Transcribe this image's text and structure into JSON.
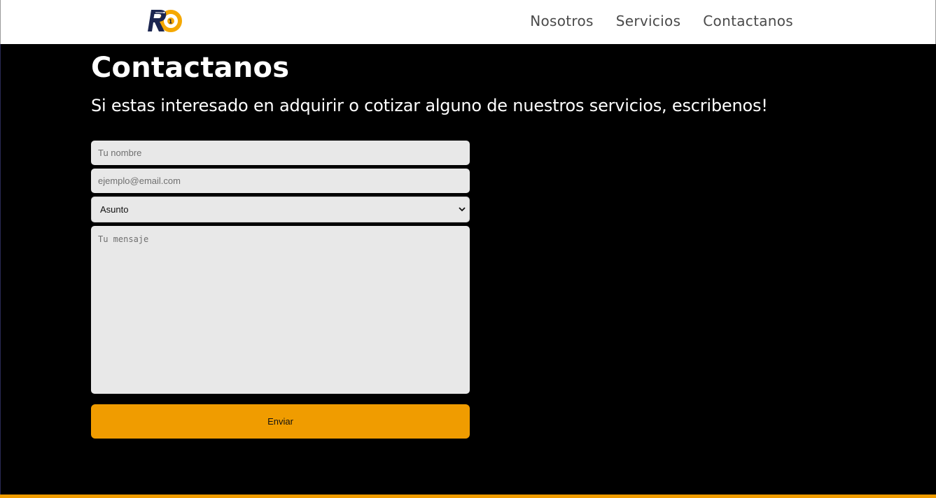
{
  "brand": {
    "logo_text": "R1",
    "colors": {
      "primary": "#1b2550",
      "accent": "#f5a800"
    }
  },
  "nav": {
    "items": [
      {
        "label": "Nosotros"
      },
      {
        "label": "Servicios"
      },
      {
        "label": "Contactanos"
      }
    ]
  },
  "contact": {
    "title": "Contactanos",
    "subtitle": "Si estas interesado en adquirir o cotizar alguno de nuestros servicios, escribenos!",
    "form": {
      "name_placeholder": "Tu nombre",
      "email_placeholder": "ejemplo@email.com",
      "subject_selected": "Asunto",
      "message_placeholder": "Tu mensaje",
      "submit_label": "Enviar"
    }
  },
  "theme": {
    "background": "#000000",
    "accent": "#f09c00",
    "field_bg": "#e8e8e8"
  }
}
